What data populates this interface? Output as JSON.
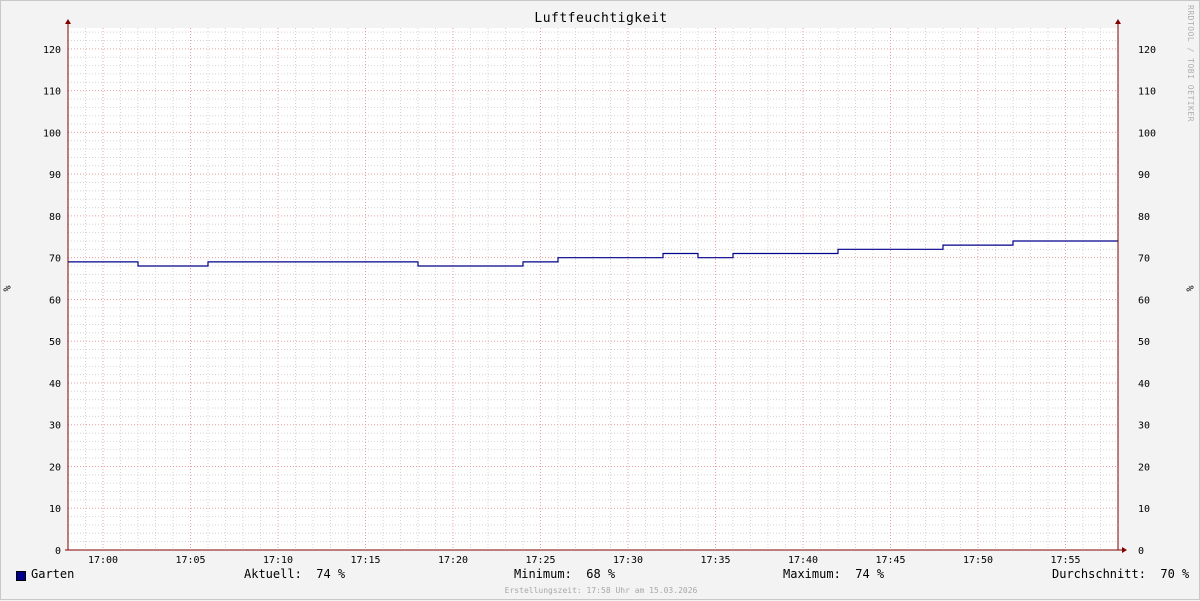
{
  "chart_data": {
    "type": "line",
    "title": "Luftfeuchtigkeit",
    "ylabel": "%",
    "ylim": [
      0,
      125
    ],
    "y_ticks": [
      0,
      10,
      20,
      30,
      40,
      50,
      60,
      70,
      80,
      90,
      100,
      110,
      120
    ],
    "x_ticks": [
      "17:00",
      "17:05",
      "17:10",
      "17:15",
      "17:20",
      "17:25",
      "17:30",
      "17:35",
      "17:40",
      "17:45",
      "17:50",
      "17:55"
    ],
    "xlim": [
      "16:58",
      "17:58"
    ],
    "grid": true,
    "legend_placement": "bottom-left",
    "series": [
      {
        "name": "Garten",
        "color": "#00008b",
        "x": [
          "16:58",
          "17:02",
          "17:06",
          "17:18",
          "17:24",
          "17:26",
          "17:32",
          "17:34",
          "17:36",
          "17:42",
          "17:48",
          "17:52",
          "17:58"
        ],
        "values": [
          69,
          68,
          69,
          68,
          69,
          70,
          71,
          70,
          71,
          72,
          73,
          74,
          74
        ]
      }
    ]
  },
  "legend": {
    "series_name": "Garten",
    "current_label": "Aktuell:",
    "current_value": "74 %",
    "min_label": "Minimum:",
    "min_value": "68 %",
    "max_label": "Maximum:",
    "max_value": "74 %",
    "avg_label": "Durchschnitt:",
    "avg_value": "70 %"
  },
  "footer": "Erstellungszeit: 17:58 Uhr am 15.03.2026",
  "watermark": "RRDTOOL / TOBI OETIKER",
  "colors": {
    "background": "#f3f3f3",
    "plot_background": "#ffffff",
    "major_grid": "#e8a0a0",
    "minor_grid": "#d4d4d4",
    "axis": "#800000",
    "series": "#00008b"
  }
}
